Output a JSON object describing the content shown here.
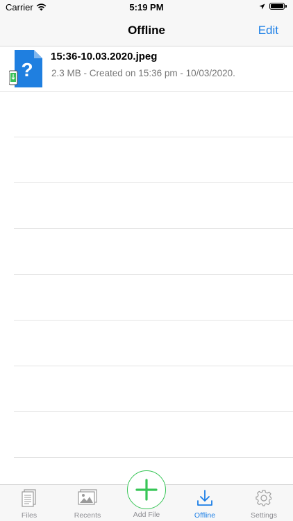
{
  "status_bar": {
    "carrier": "Carrier",
    "time": "5:19 PM"
  },
  "nav": {
    "title": "Offline",
    "edit_label": "Edit"
  },
  "files": [
    {
      "name": "15:36-10.03.2020.jpeg",
      "details": "2.3 MB - Created on 15:36 pm - 10/03/2020."
    }
  ],
  "tab_bar": {
    "tabs": [
      {
        "label": "Files",
        "icon": "files-icon"
      },
      {
        "label": "Recents",
        "icon": "recents-icon"
      },
      {
        "label": "Add File",
        "icon": "add-icon"
      },
      {
        "label": "Offline",
        "icon": "download-icon",
        "active": true
      },
      {
        "label": "Settings",
        "icon": "gear-icon"
      }
    ]
  },
  "colors": {
    "accent": "#1a7ee6",
    "add_green": "#37c556",
    "file_icon_blue": "#1f7fe0",
    "inactive_tab": "#8e8e93"
  }
}
